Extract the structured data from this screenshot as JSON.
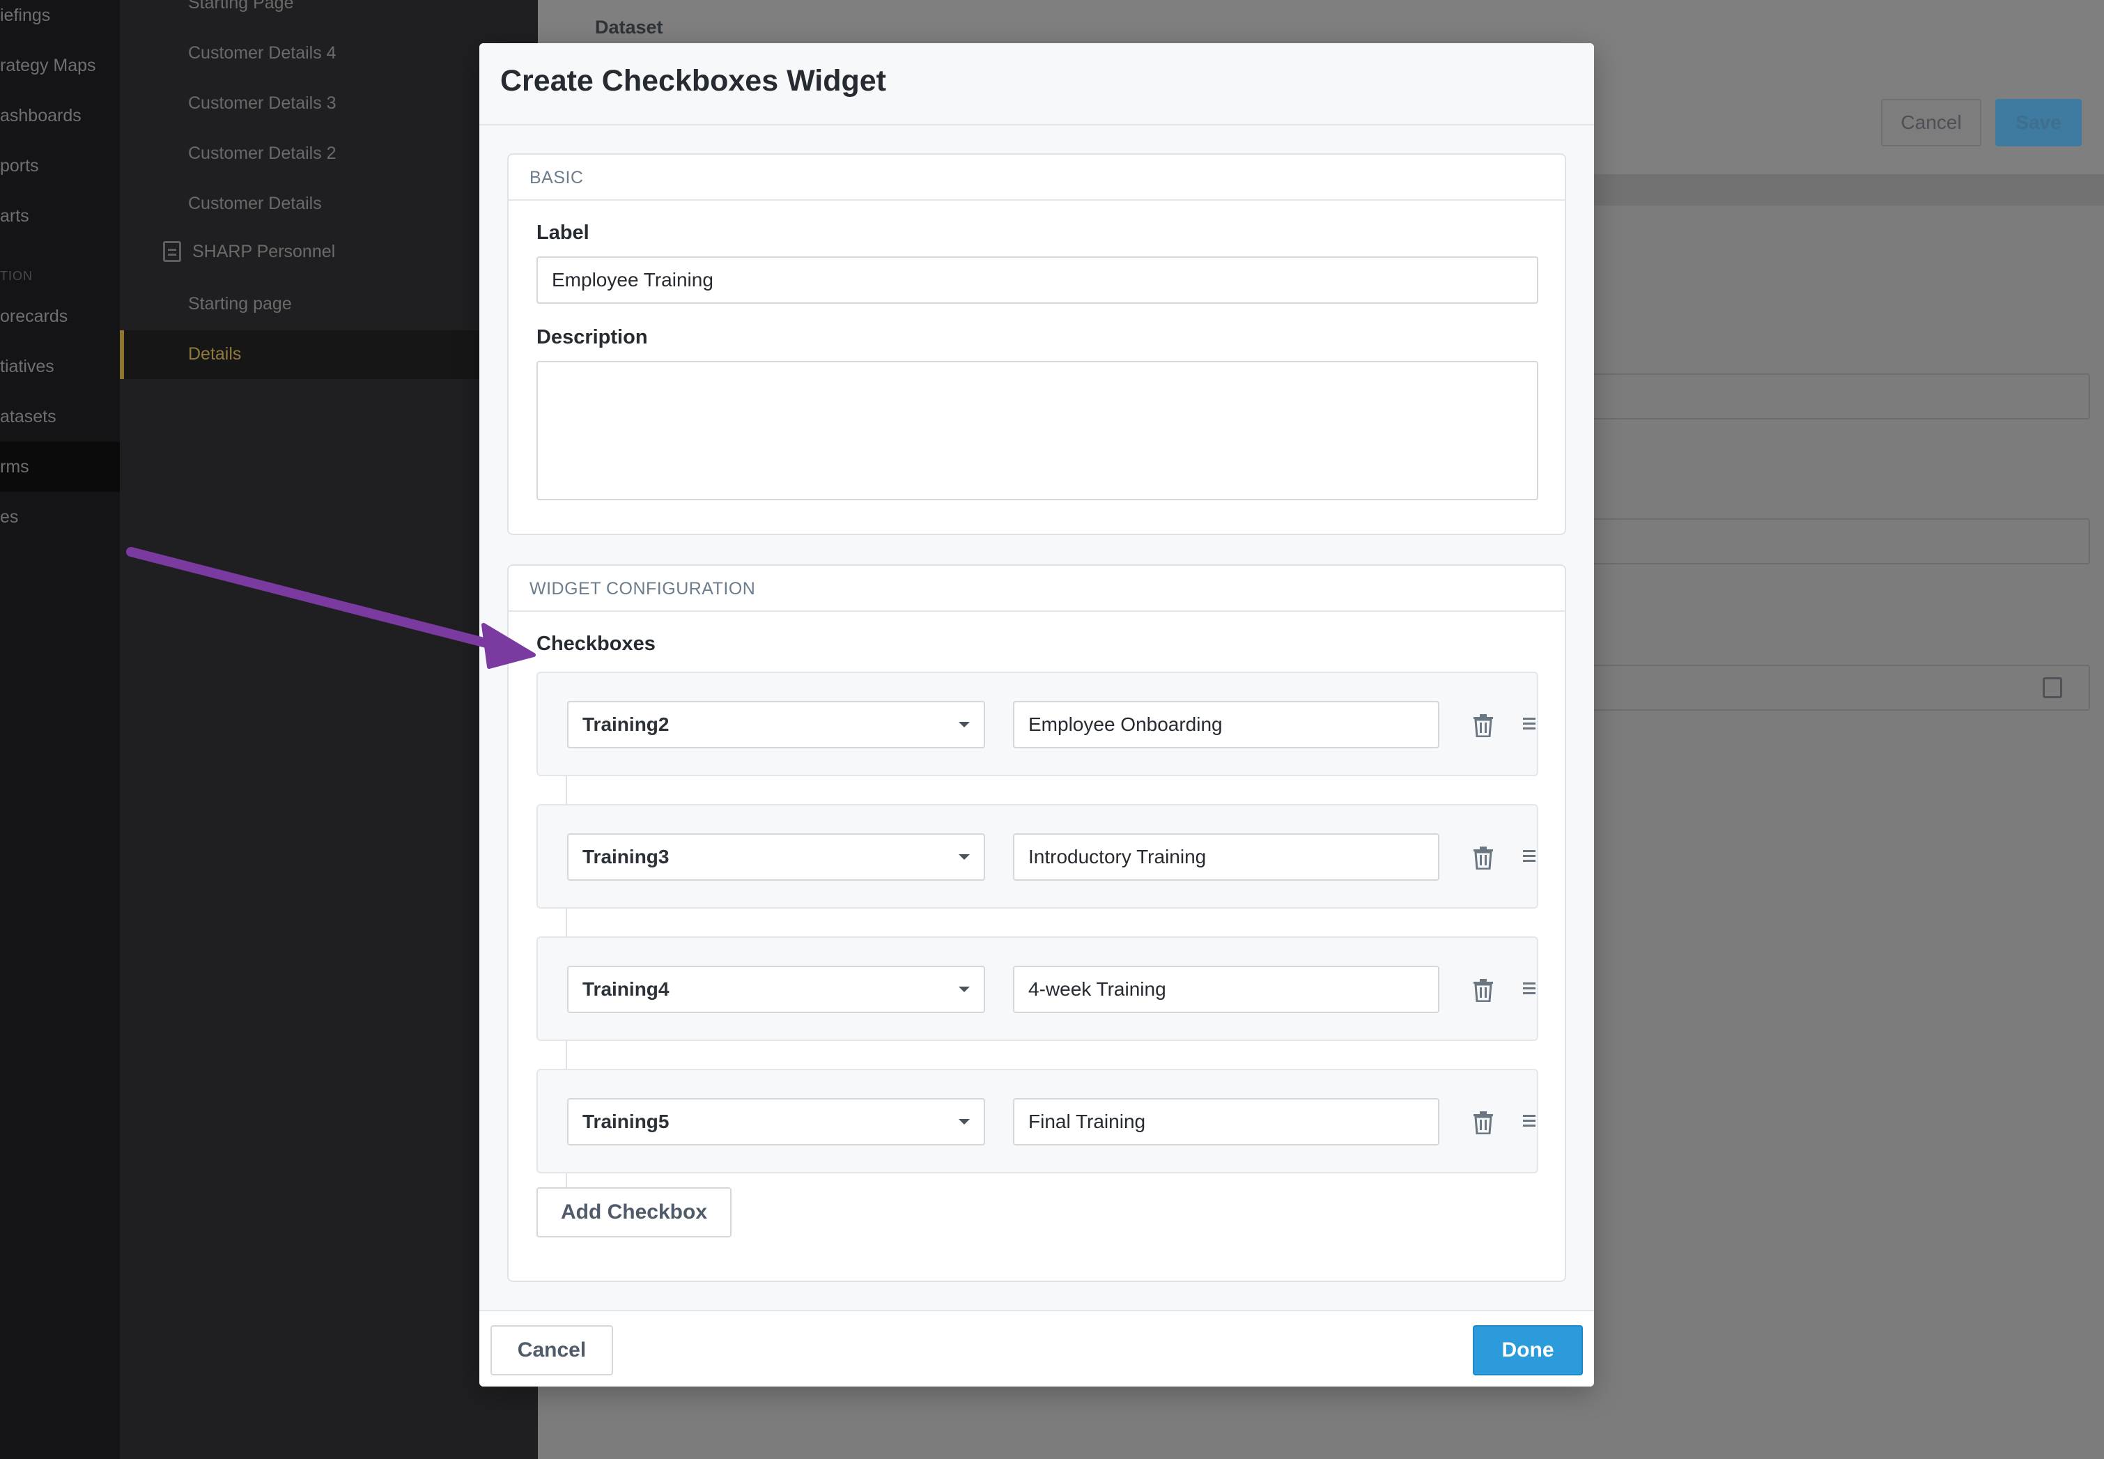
{
  "left_nav": {
    "items": [
      "iefings",
      "rategy Maps",
      "ashboards",
      "ports",
      "arts",
      "orecards",
      "tiatives",
      "atasets",
      "rms",
      "es"
    ],
    "section_head": "TION",
    "active_index": 8
  },
  "sub_nav": {
    "items": [
      "Starting Page",
      "Customer Details 4",
      "Customer Details 3",
      "Customer Details 2",
      "Customer Details",
      "SHARP Personnel",
      "Starting page",
      "Details"
    ],
    "active_index": 7
  },
  "background": {
    "dataset_label": "Dataset",
    "cancel_label": "Cancel",
    "save_label": "Save"
  },
  "modal": {
    "title": "Create Checkboxes Widget",
    "basic": {
      "heading": "BASIC",
      "label_label": "Label",
      "label_value": "Employee Training",
      "description_label": "Description",
      "description_value": ""
    },
    "widget_config": {
      "heading": "WIDGET CONFIGURATION",
      "checkboxes_label": "Checkboxes",
      "rows": [
        {
          "field": "Training2",
          "label": "Employee Onboarding"
        },
        {
          "field": "Training3",
          "label": "Introductory Training"
        },
        {
          "field": "Training4",
          "label": "4-week Training"
        },
        {
          "field": "Training5",
          "label": "Final Training"
        }
      ],
      "add_label": "Add Checkbox"
    },
    "footer": {
      "cancel_label": "Cancel",
      "done_label": "Done"
    }
  },
  "colors": {
    "accent": "#2b9bdc",
    "annotation_arrow": "#7b3aa0",
    "active_nav": "#8e7630"
  }
}
